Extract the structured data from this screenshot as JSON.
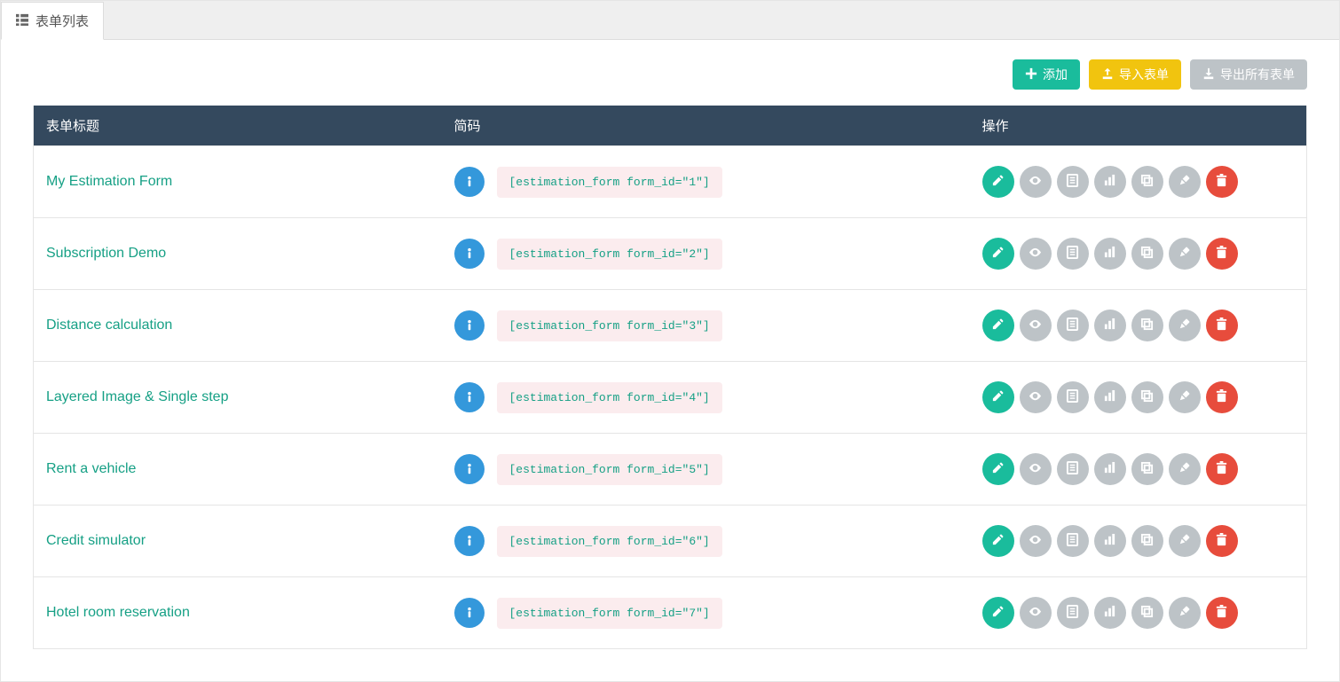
{
  "tab": {
    "label": "表单列表"
  },
  "toolbar": {
    "add_label": "添加",
    "import_label": "导入表单",
    "export_label": "导出所有表单"
  },
  "table": {
    "headers": {
      "title": "表单标题",
      "shortcode": "简码",
      "actions": "操作"
    },
    "rows": [
      {
        "title": "My Estimation Form",
        "shortcode": "[estimation_form form_id=\"1\"]"
      },
      {
        "title": "Subscription Demo",
        "shortcode": "[estimation_form form_id=\"2\"]"
      },
      {
        "title": "Distance calculation",
        "shortcode": "[estimation_form form_id=\"3\"]"
      },
      {
        "title": "Layered Image & Single step",
        "shortcode": "[estimation_form form_id=\"4\"]"
      },
      {
        "title": "Rent a vehicle",
        "shortcode": "[estimation_form form_id=\"5\"]"
      },
      {
        "title": "Credit simulator",
        "shortcode": "[estimation_form form_id=\"6\"]"
      },
      {
        "title": "Hotel room reservation",
        "shortcode": "[estimation_form form_id=\"7\"]"
      }
    ]
  },
  "action_icons": [
    "edit",
    "preview",
    "entries",
    "stats",
    "duplicate",
    "design",
    "delete"
  ]
}
